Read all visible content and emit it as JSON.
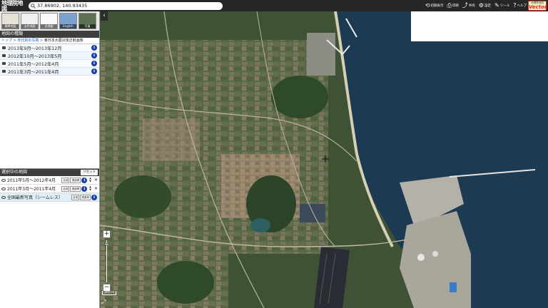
{
  "header": {
    "logo_title": "地理院地図",
    "logo_sub": "(電子国土Web)",
    "search_value": "37.86902, 140.93435",
    "tools": [
      {
        "icon": "reset-icon",
        "glyph": "⟲",
        "label": "初期表示"
      },
      {
        "icon": "print-icon",
        "glyph": "⎙",
        "label": "印刷"
      },
      {
        "icon": "share-icon",
        "glyph": "⤴",
        "label": "共有"
      },
      {
        "icon": "gear-icon",
        "glyph": "⚙",
        "label": "設定"
      },
      {
        "icon": "wrench-icon",
        "glyph": "✎",
        "label": "ツール"
      },
      {
        "icon": "help-icon",
        "glyph": "?",
        "label": "ヘルプ"
      }
    ],
    "vector_small": "地理院地図",
    "vector_label": "Vector"
  },
  "basemaps": [
    {
      "label": "標準地図",
      "icon": "standard-map-thumb"
    },
    {
      "label": "淡色地図",
      "icon": "pale-map-thumb"
    },
    {
      "label": "白地図",
      "icon": "blank-map-thumb"
    },
    {
      "label": "English",
      "icon": "english-map-thumb"
    },
    {
      "label": "写真",
      "icon": "photo-map-thumb"
    }
  ],
  "map_types": {
    "title": "地図の種類",
    "breadcrumb": [
      "トップ",
      "年代別の写真",
      "東日本大震災後正射画像"
    ],
    "items": [
      {
        "label": "2013年9月～2013年12月"
      },
      {
        "label": "2012年10月～2013年5月"
      },
      {
        "label": "2011年5月～2012年4月"
      },
      {
        "label": "2011年3月～2011年4月"
      }
    ]
  },
  "selected": {
    "title": "選択中の地図",
    "reset_label": "リセット",
    "items": [
      {
        "label": "2011年5月～2012年4月",
        "btn1": "合成",
        "btn2": "透過率"
      },
      {
        "label": "2011年3月～2011年4月",
        "btn1": "合成",
        "btn2": "透過率"
      },
      {
        "label": "全国最新写真（シームレス）",
        "btn1": "合成",
        "btn2": "透過率"
      }
    ]
  },
  "map": {
    "scale_label": "300 m",
    "zoom_in": "+",
    "zoom_out": "−",
    "collapse_glyph": "‹",
    "expand_glyph": "⤢"
  },
  "colors": {
    "topbar": "#262626",
    "sea": "#1c3a52",
    "land": "#4f6141",
    "info": "#1b3fa3"
  }
}
